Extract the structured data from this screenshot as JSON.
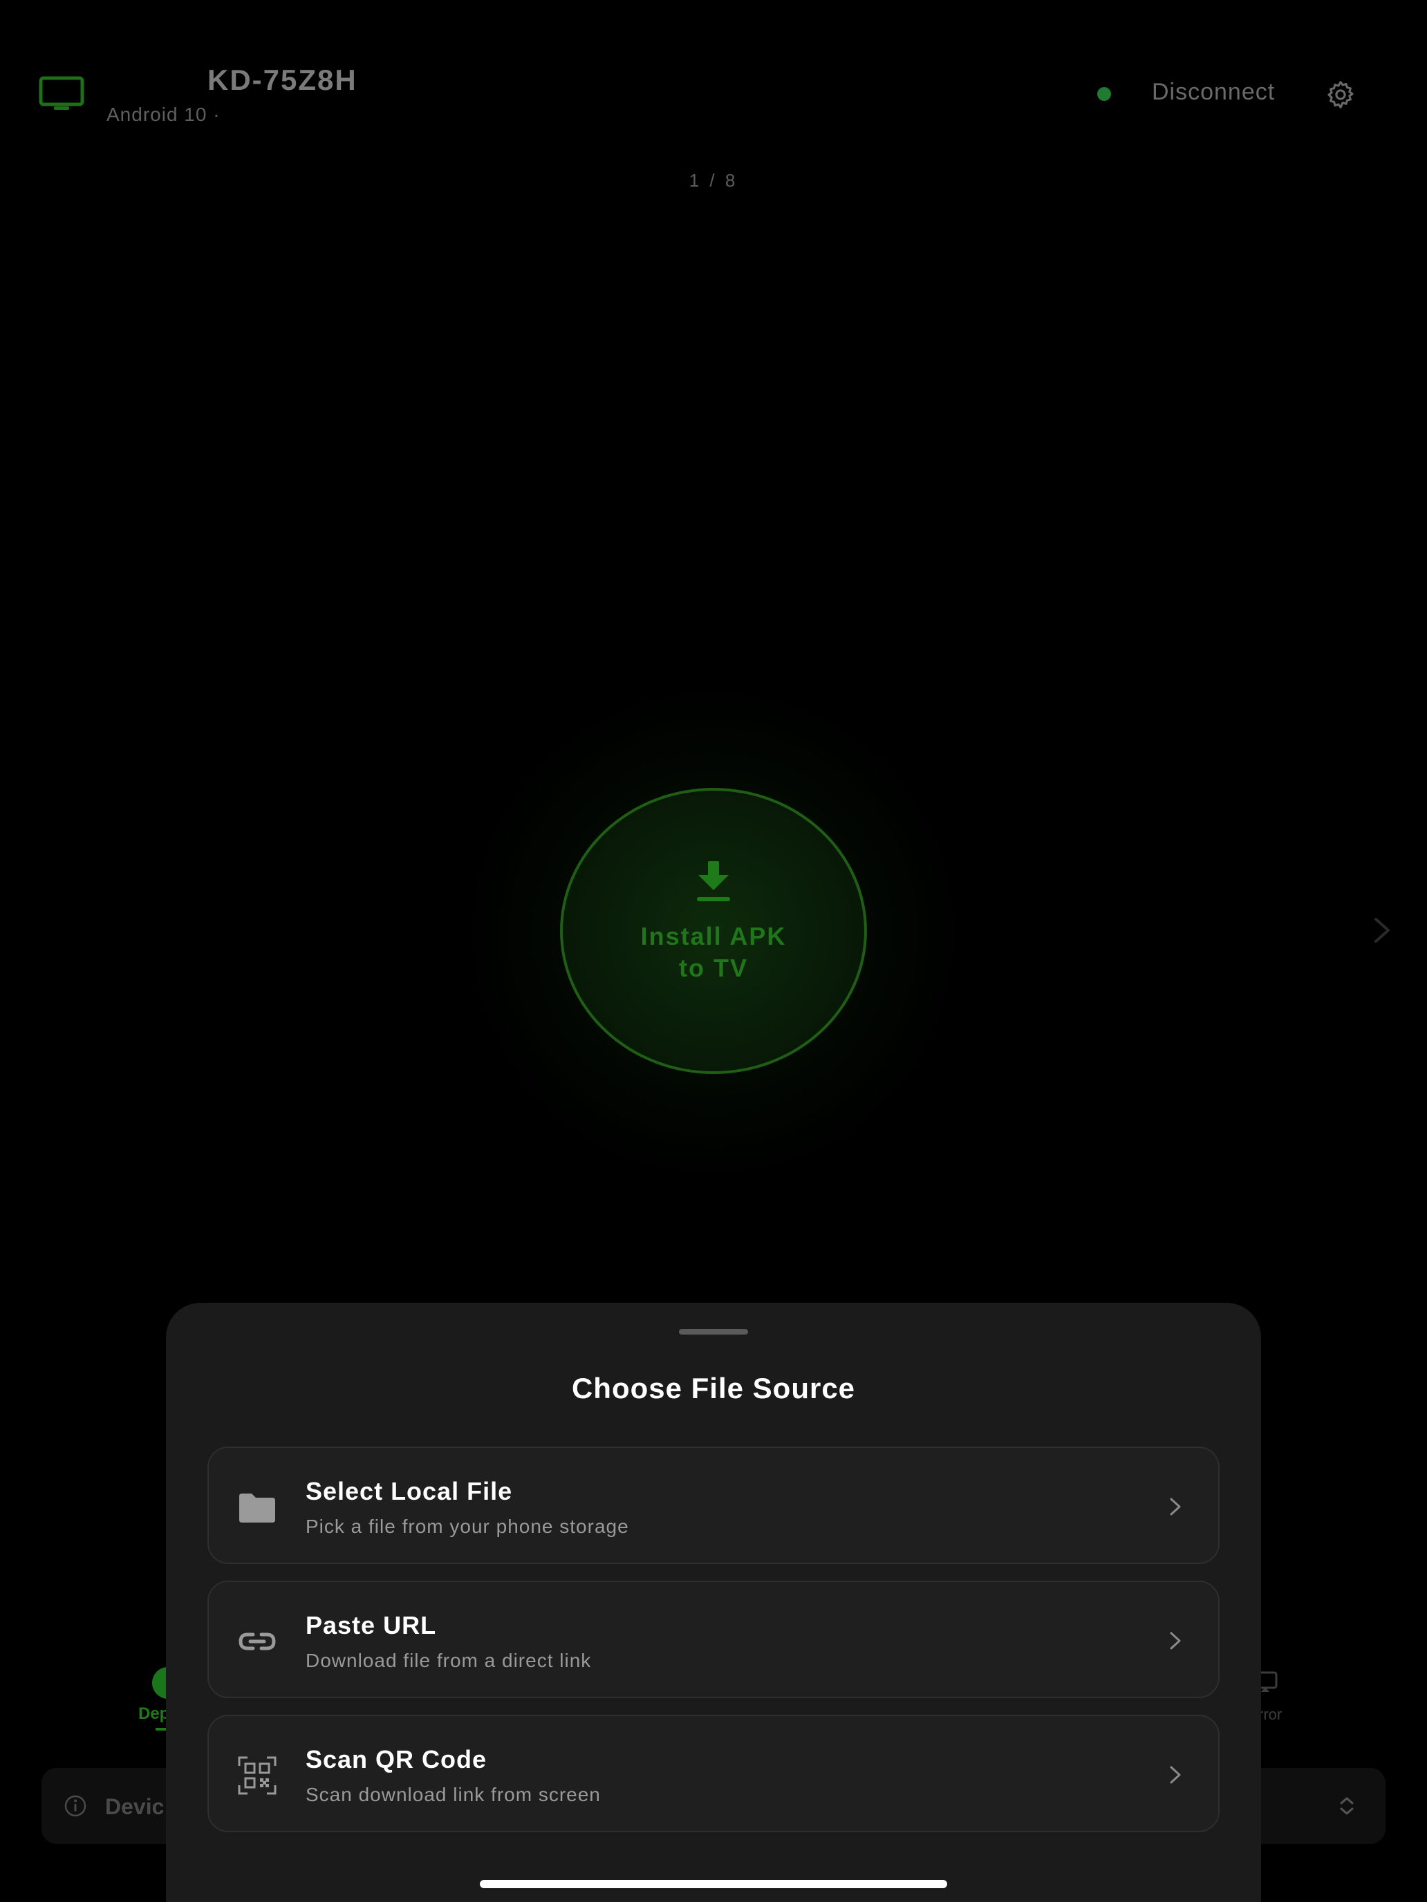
{
  "header": {
    "device_name": "KD-75Z8H",
    "device_subtitle": "Android 10 ·",
    "disconnect_label": "Disconnect",
    "connection_status_color": "#1f7a32"
  },
  "carousel": {
    "page_indicator": "1 / 8",
    "current_page": 1,
    "total_pages": 8
  },
  "install_button": {
    "label": "Install APK to TV",
    "icon": "download-icon",
    "accent_color": "#21751a"
  },
  "tabs": {
    "left_label": "Dep",
    "right_label": "rror"
  },
  "device_bar": {
    "label": "Devic"
  },
  "sheet": {
    "title": "Choose File Source",
    "options": [
      {
        "icon": "folder-icon",
        "title": "Select Local File",
        "description": "Pick a file from your phone storage"
      },
      {
        "icon": "link-icon",
        "title": "Paste URL",
        "description": "Download file from a direct link"
      },
      {
        "icon": "qr-code-icon",
        "title": "Scan QR Code",
        "description": "Scan download link from screen"
      }
    ]
  },
  "colors": {
    "background": "#000000",
    "sheet_background": "#1b1b1b",
    "accent_green": "#1f7a1a"
  }
}
